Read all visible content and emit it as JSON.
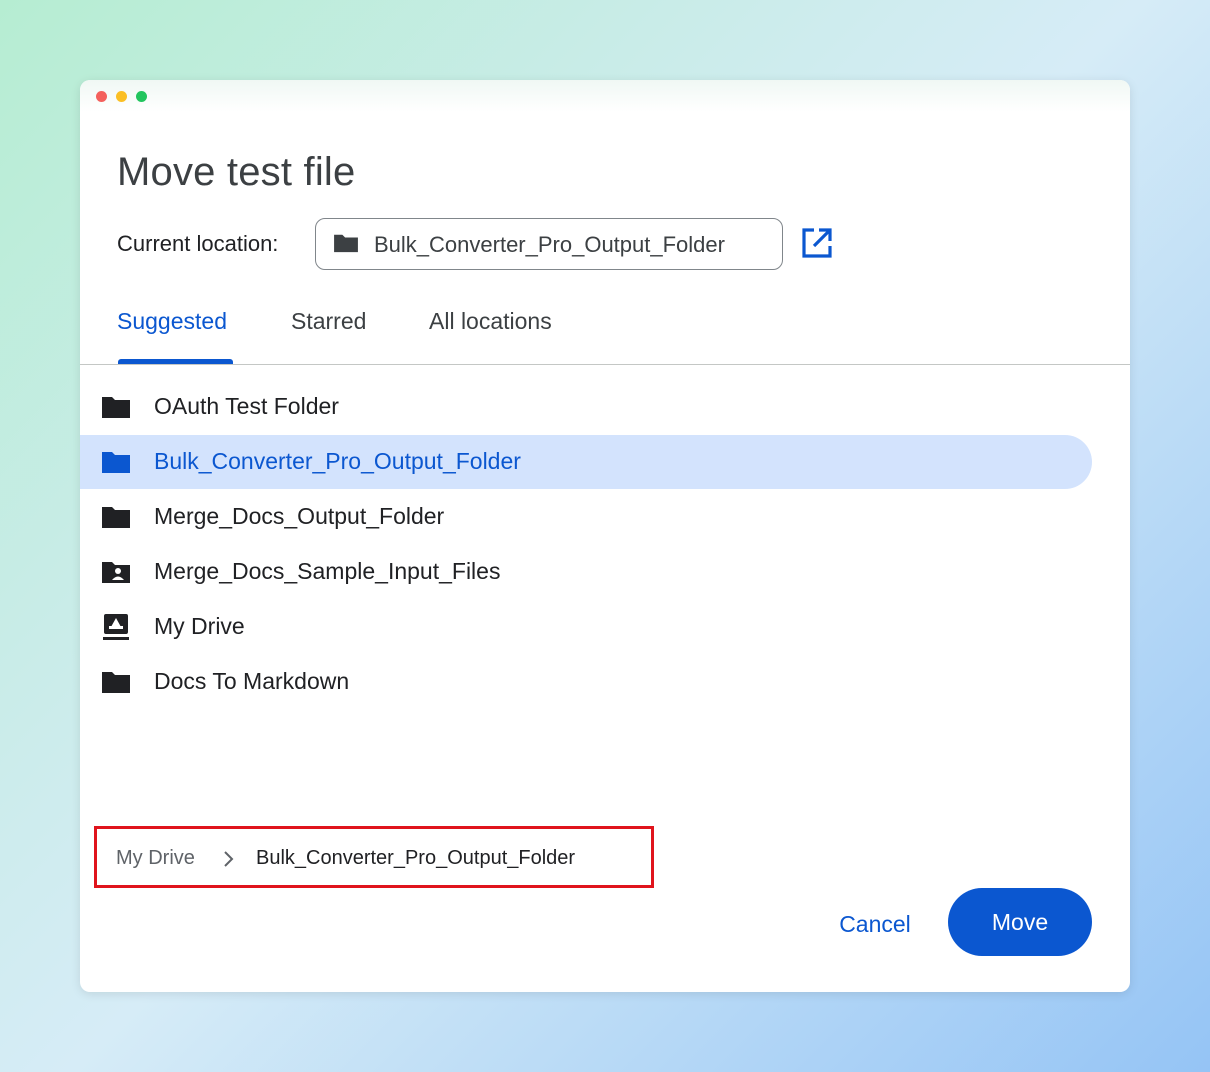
{
  "colors": {
    "accent": "#0b57d0",
    "selected_row_bg": "#d3e3fd",
    "annotation_border": "#e0141c",
    "folder_icon": "#202124"
  },
  "dialog": {
    "title": "Move test file",
    "current_location_label": "Current location:",
    "current_location_value": "Bulk_Converter_Pro_Output_Folder"
  },
  "tabs": [
    {
      "label": "Suggested",
      "active": true
    },
    {
      "label": "Starred",
      "active": false
    },
    {
      "label": "All locations",
      "active": false
    }
  ],
  "folders": [
    {
      "label": "OAuth Test Folder",
      "icon": "folder-icon",
      "selected": false
    },
    {
      "label": "Bulk_Converter_Pro_Output_Folder",
      "icon": "folder-icon",
      "selected": true
    },
    {
      "label": "Merge_Docs_Output_Folder",
      "icon": "folder-icon",
      "selected": false
    },
    {
      "label": "Merge_Docs_Sample_Input_Files",
      "icon": "shared-folder-icon",
      "selected": false
    },
    {
      "label": "My Drive",
      "icon": "my-drive-icon",
      "selected": false
    },
    {
      "label": "Docs To Markdown",
      "icon": "folder-icon",
      "selected": false
    }
  ],
  "breadcrumb": {
    "root": "My Drive",
    "current": "Bulk_Converter_Pro_Output_Folder"
  },
  "actions": {
    "cancel_label": "Cancel",
    "move_label": "Move"
  }
}
